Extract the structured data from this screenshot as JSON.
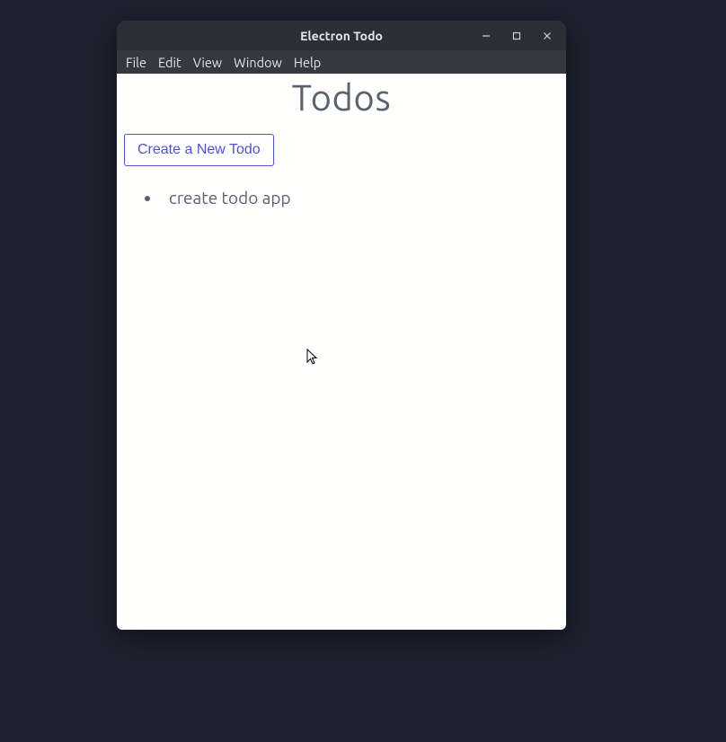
{
  "window": {
    "title": "Electron Todo"
  },
  "menubar": {
    "items": [
      {
        "label": "File"
      },
      {
        "label": "Edit"
      },
      {
        "label": "View"
      },
      {
        "label": "Window"
      },
      {
        "label": "Help"
      }
    ]
  },
  "page": {
    "heading": "Todos",
    "create_button_label": "Create a New Todo"
  },
  "todos": [
    {
      "text": "create todo app"
    }
  ]
}
